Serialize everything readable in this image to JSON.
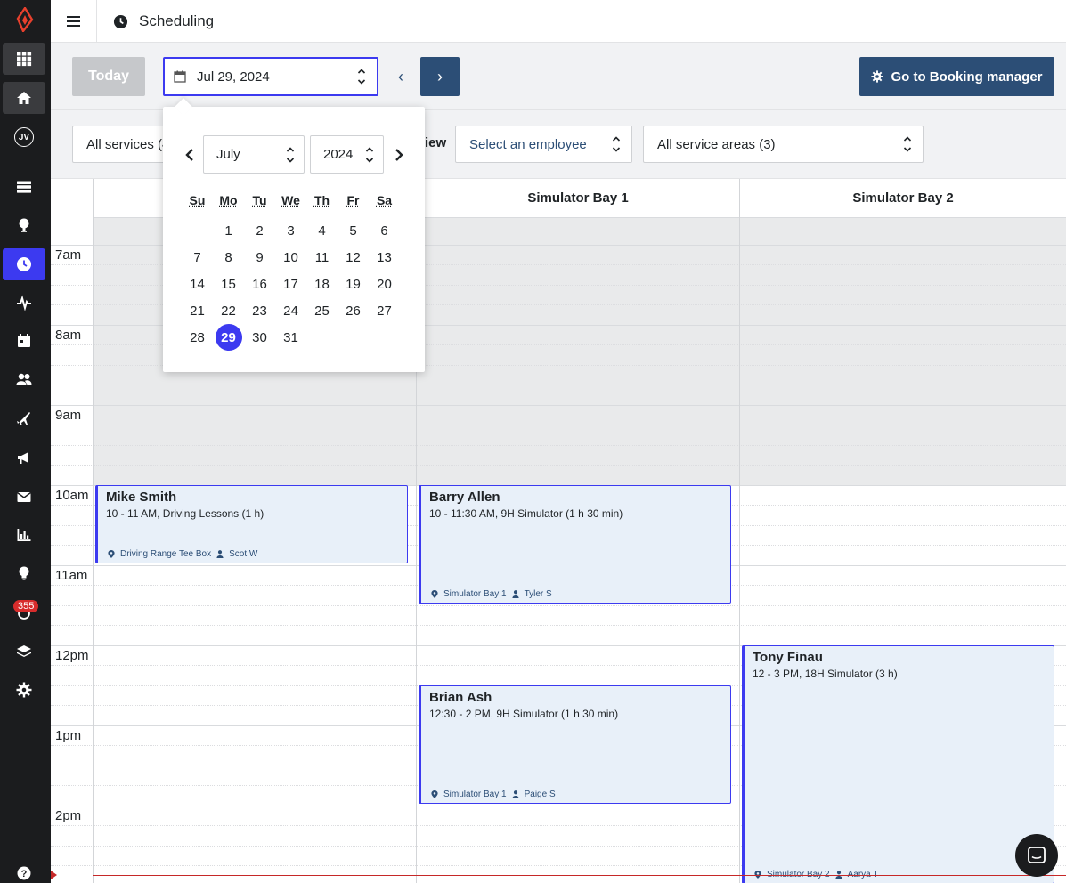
{
  "app": {
    "title": "Scheduling"
  },
  "sidebar": {
    "avatar_initials": "JV",
    "notification_count": "355",
    "items": [
      {
        "icon": "grid-icon"
      },
      {
        "icon": "home-icon"
      },
      {
        "icon": "avatar"
      },
      {
        "icon": "list-icon"
      },
      {
        "icon": "golf-icon"
      },
      {
        "icon": "clock-icon"
      },
      {
        "icon": "activity-icon"
      },
      {
        "icon": "calendar-icon"
      },
      {
        "icon": "users-icon"
      },
      {
        "icon": "plane-icon"
      },
      {
        "icon": "megaphone-icon"
      },
      {
        "icon": "mail-icon"
      },
      {
        "icon": "chart-icon"
      },
      {
        "icon": "lightbulb-icon"
      },
      {
        "icon": "notification-icon"
      },
      {
        "icon": "layers-icon"
      },
      {
        "icon": "gear-icon"
      },
      {
        "icon": "help-icon"
      }
    ]
  },
  "toolbar": {
    "today_label": "Today",
    "date_value": "Jul 29, 2024",
    "prev_label": "‹",
    "next_label": "›",
    "booking_label": "Go to Booking manager"
  },
  "filters": {
    "services": "All services (4",
    "view_label": "iew",
    "employee_placeholder": "Select an employee",
    "areas": "All service areas (3)"
  },
  "columns": [
    {
      "name": ""
    },
    {
      "name": "Simulator Bay 1"
    },
    {
      "name": "Simulator Bay 2"
    }
  ],
  "times": [
    "7am",
    "8am",
    "9am",
    "10am",
    "11am",
    "12pm",
    "1pm",
    "2pm"
  ],
  "events": [
    {
      "name": "Mike Smith",
      "detail": "10 - 11 AM, Driving Lessons (1 h)",
      "location": "Driving Range Tee Box",
      "staff": "Scot W"
    },
    {
      "name": "Barry Allen",
      "detail": "10 - 11:30 AM, 9H Simulator (1 h 30 min)",
      "location": "Simulator Bay 1",
      "staff": "Tyler S"
    },
    {
      "name": "Brian Ash",
      "detail": "12:30 - 2 PM, 9H Simulator (1 h 30 min)",
      "location": "Simulator Bay 1",
      "staff": "Paige S"
    },
    {
      "name": "Tony Finau",
      "detail": "12 - 3 PM, 18H Simulator (3 h)",
      "location": "Simulator Bay 2",
      "staff": "Aarya T"
    }
  ],
  "datepicker": {
    "month": "July",
    "year": "2024",
    "weekdays": [
      "Su",
      "Mo",
      "Tu",
      "We",
      "Th",
      "Fr",
      "Sa"
    ],
    "weeks": [
      [
        "",
        "1",
        "2",
        "3",
        "4",
        "5",
        "6"
      ],
      [
        "7",
        "8",
        "9",
        "10",
        "11",
        "12",
        "13"
      ],
      [
        "14",
        "15",
        "16",
        "17",
        "18",
        "19",
        "20"
      ],
      [
        "21",
        "22",
        "23",
        "24",
        "25",
        "26",
        "27"
      ],
      [
        "28",
        "29",
        "30",
        "31",
        "",
        "",
        ""
      ]
    ],
    "selected_day": "29"
  },
  "colors": {
    "accent": "#3c3af0",
    "brand_dark": "#2c4e76",
    "rail": "#1b1c1e"
  }
}
